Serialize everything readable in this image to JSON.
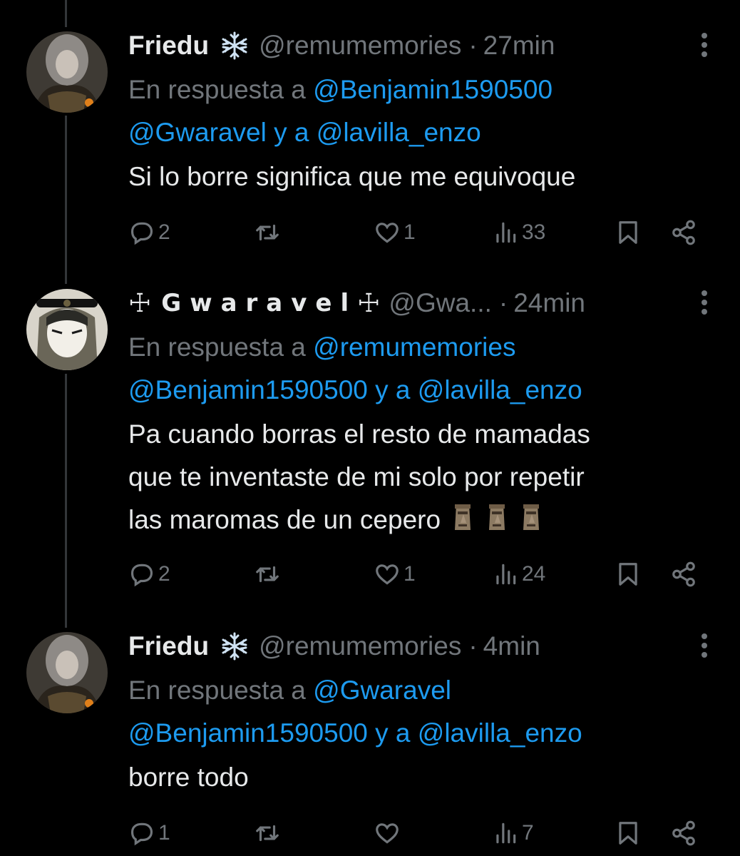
{
  "tweets": [
    {
      "author": "Friedu",
      "handle": "@remumemories",
      "time": "27min",
      "reply_prefix": "En respuesta a ",
      "reply_line1_mention": "@Benjamin1590500",
      "reply_line2_mention1": "@Gwaravel",
      "reply_line2_join": " y a ",
      "reply_line2_mention2": "@lavilla_enzo",
      "text": [
        "Si lo borre significa que me equivoque"
      ],
      "counts": {
        "replies": "2",
        "retweets": "",
        "likes": "1",
        "views": "33"
      }
    },
    {
      "author": "Gwaravel",
      "author_cross": "☩",
      "handle": "@Gwa...",
      "time": "24min",
      "reply_prefix": "En respuesta a ",
      "reply_line1_mention": "@remumemories",
      "reply_line2_mention1": "@Benjamin1590500",
      "reply_line2_join": " y a ",
      "reply_line2_mention2": "@lavilla_enzo",
      "text": [
        "Pa cuando borras el resto de mamadas",
        "que te inventaste de mi solo por repetir",
        "las maromas de un cepero"
      ],
      "emoji": "moai-icon",
      "counts": {
        "replies": "2",
        "retweets": "",
        "likes": "1",
        "views": "24"
      }
    },
    {
      "author": "Friedu",
      "handle": "@remumemories",
      "time": "4min",
      "reply_prefix": "En respuesta a ",
      "reply_line1_mention": "@Gwaravel",
      "reply_line2_mention1": "@Benjamin1590500",
      "reply_line2_join": " y a ",
      "reply_line2_mention2": "@lavilla_enzo",
      "text": [
        "borre todo"
      ],
      "counts": {
        "replies": "1",
        "retweets": "",
        "likes": "",
        "views": "7"
      }
    }
  ],
  "colors": {
    "background": "#000000",
    "text": "#e7e9ea",
    "muted": "#71767b",
    "mention": "#1d9bf0",
    "line": "#333639"
  },
  "icons": [
    "snowflake-icon",
    "more-icon",
    "reply-icon",
    "retweet-icon",
    "like-icon",
    "views-icon",
    "bookmark-icon",
    "share-icon",
    "moai-icon"
  ]
}
